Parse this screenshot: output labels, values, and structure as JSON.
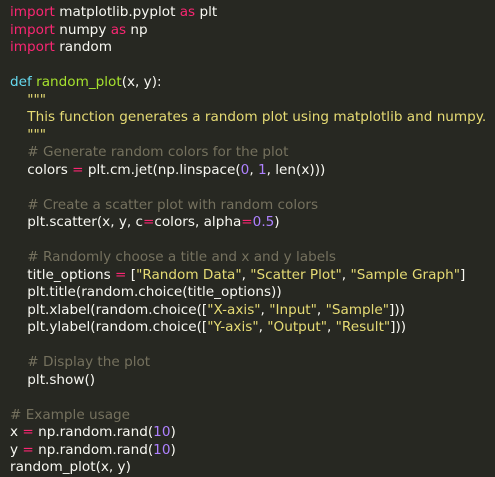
{
  "editor": {
    "background": "#272822",
    "colors": {
      "kw": "#f92672",
      "def": "#66d9ef",
      "fn": "#a6e22e",
      "str": "#e6db74",
      "num": "#ae81ff",
      "cmt": "#75715e",
      "txt": "#f8f8f2"
    },
    "lines": [
      [
        [
          "kw",
          "import"
        ],
        [
          "txt",
          " matplotlib.pyplot "
        ],
        [
          "kw",
          "as"
        ],
        [
          "txt",
          " plt"
        ]
      ],
      [
        [
          "kw",
          "import"
        ],
        [
          "txt",
          " numpy "
        ],
        [
          "kw",
          "as"
        ],
        [
          "txt",
          " np"
        ]
      ],
      [
        [
          "kw",
          "import"
        ],
        [
          "txt",
          " random"
        ]
      ],
      [],
      [
        [
          "def",
          "def"
        ],
        [
          "txt",
          " "
        ],
        [
          "fn",
          "random_plot"
        ],
        [
          "txt",
          "(x, y):"
        ]
      ],
      [
        [
          "txt",
          "    "
        ],
        [
          "str",
          "\"\"\""
        ]
      ],
      [
        [
          "txt",
          "    "
        ],
        [
          "str",
          "This function generates a random plot using matplotlib and numpy."
        ]
      ],
      [
        [
          "txt",
          "    "
        ],
        [
          "str",
          "\"\"\""
        ]
      ],
      [
        [
          "txt",
          "    "
        ],
        [
          "cmt",
          "# Generate random colors for the plot"
        ]
      ],
      [
        [
          "txt",
          "    colors "
        ],
        [
          "kw",
          "="
        ],
        [
          "txt",
          " plt.cm.jet(np.linspace("
        ],
        [
          "num",
          "0"
        ],
        [
          "txt",
          ", "
        ],
        [
          "num",
          "1"
        ],
        [
          "txt",
          ", len(x)))"
        ]
      ],
      [],
      [
        [
          "txt",
          "    "
        ],
        [
          "cmt",
          "# Create a scatter plot with random colors"
        ]
      ],
      [
        [
          "txt",
          "    plt.scatter(x, y, c"
        ],
        [
          "kw",
          "="
        ],
        [
          "txt",
          "colors, alpha"
        ],
        [
          "kw",
          "="
        ],
        [
          "num",
          "0.5"
        ],
        [
          "txt",
          ")"
        ]
      ],
      [],
      [
        [
          "txt",
          "    "
        ],
        [
          "cmt",
          "# Randomly choose a title and x and y labels"
        ]
      ],
      [
        [
          "txt",
          "    title_options "
        ],
        [
          "kw",
          "="
        ],
        [
          "txt",
          " ["
        ],
        [
          "str",
          "\"Random Data\""
        ],
        [
          "txt",
          ", "
        ],
        [
          "str",
          "\"Scatter Plot\""
        ],
        [
          "txt",
          ", "
        ],
        [
          "str",
          "\"Sample Graph\""
        ],
        [
          "txt",
          "]"
        ]
      ],
      [
        [
          "txt",
          "    plt.title(random.choice(title_options))"
        ]
      ],
      [
        [
          "txt",
          "    plt.xlabel(random.choice(["
        ],
        [
          "str",
          "\"X-axis\""
        ],
        [
          "txt",
          ", "
        ],
        [
          "str",
          "\"Input\""
        ],
        [
          "txt",
          ", "
        ],
        [
          "str",
          "\"Sample\""
        ],
        [
          "txt",
          "]))"
        ]
      ],
      [
        [
          "txt",
          "    plt.ylabel(random.choice(["
        ],
        [
          "str",
          "\"Y-axis\""
        ],
        [
          "txt",
          ", "
        ],
        [
          "str",
          "\"Output\""
        ],
        [
          "txt",
          ", "
        ],
        [
          "str",
          "\"Result\""
        ],
        [
          "txt",
          "]))"
        ]
      ],
      [],
      [
        [
          "txt",
          "    "
        ],
        [
          "cmt",
          "# Display the plot"
        ]
      ],
      [
        [
          "txt",
          "    plt.show()"
        ]
      ],
      [],
      [
        [
          "cmt",
          "# Example usage"
        ]
      ],
      [
        [
          "txt",
          "x "
        ],
        [
          "kw",
          "="
        ],
        [
          "txt",
          " np.random.rand("
        ],
        [
          "num",
          "10"
        ],
        [
          "txt",
          ")"
        ]
      ],
      [
        [
          "txt",
          "y "
        ],
        [
          "kw",
          "="
        ],
        [
          "txt",
          " np.random.rand("
        ],
        [
          "num",
          "10"
        ],
        [
          "txt",
          ")"
        ]
      ],
      [
        [
          "txt",
          "random_plot(x, y)"
        ]
      ]
    ]
  }
}
